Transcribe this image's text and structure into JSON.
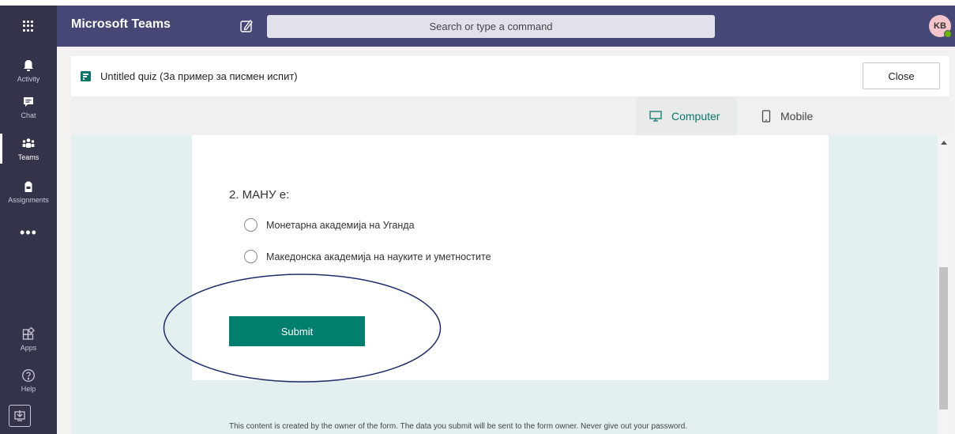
{
  "app": {
    "title": "Microsoft Teams",
    "search_placeholder": "Search or type a command",
    "avatar_initials": "KB",
    "presence_color": "#6bb700"
  },
  "rail": {
    "items": [
      {
        "label": "Activity",
        "icon": "bell-icon"
      },
      {
        "label": "Chat",
        "icon": "chat-icon"
      },
      {
        "label": "Teams",
        "icon": "teams-icon",
        "active": true
      },
      {
        "label": "Assignments",
        "icon": "backpack-icon"
      },
      {
        "label": "Apps",
        "icon": "apps-icon"
      },
      {
        "label": "Help",
        "icon": "help-icon"
      }
    ],
    "more": "•••"
  },
  "header": {
    "quiz_title": "Untitled quiz (За пример за писмен испит)",
    "close_label": "Close"
  },
  "preview": {
    "computer_label": "Computer",
    "mobile_label": "Mobile",
    "selected": "Computer",
    "accent_color": "#077568"
  },
  "form": {
    "question": "2. МАНУ е:",
    "options": [
      "Монетарна академија на Уганда",
      "Македонска академија на науките и уметностите"
    ],
    "submit_label": "Submit",
    "submit_color": "#007f6e",
    "footer": "This content is created by the owner of the form. The data you submit will be sent to the form owner. Never give out your password."
  },
  "colors": {
    "titlebar": "#464775",
    "rail": "#33344a",
    "annotation_ellipse": "#1f2d6b"
  }
}
